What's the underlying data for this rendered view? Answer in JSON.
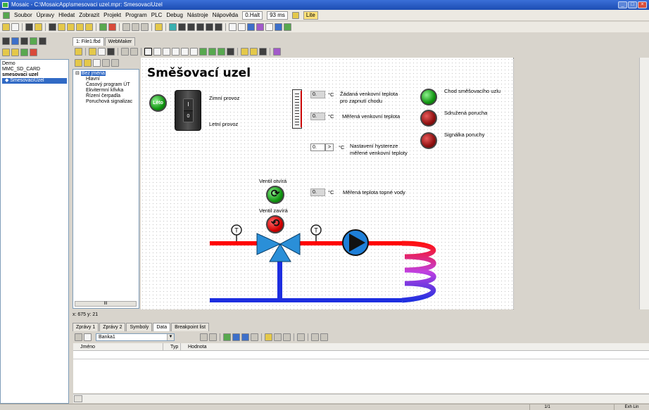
{
  "window": {
    "title": "Mosaic - C:\\MosaicApp\\smesovaci uzel.mpr: SmesovaciUzel"
  },
  "menu": {
    "items": [
      "Soubor",
      "Úpravy",
      "Hledat",
      "Zobrazit",
      "Projekt",
      "Program",
      "PLC",
      "Debug",
      "Nástroje",
      "Nápověda"
    ],
    "halt": "0.Halt",
    "cycle": "93 ms",
    "live": "Lite"
  },
  "left_tree": {
    "items": [
      "Demo",
      "MMC_SD_CARD",
      "smesovaci uzel",
      "SmesovaciUzel"
    ]
  },
  "editor_tabs": [
    "1: File1.fbd",
    "WebMaker"
  ],
  "page_tree": {
    "root": "Bez jména",
    "children": [
      "Hlavní",
      "Časový program ÚT",
      "Ekvitermní křivka",
      "Řízení čerpadla",
      "Poruchová signalizac"
    ]
  },
  "scene": {
    "title": "Směšovací uzel",
    "leto": "Léto",
    "switch_on": "I",
    "switch_off": "0",
    "winter": "Zimní provoz",
    "summer": "Letní provoz",
    "req_temp_value": "0.",
    "req_temp_unit": "°C",
    "req_temp_label_1": "Žádaná venkovní teplota",
    "req_temp_label_2": "pro zapnutí chodu",
    "meas_out_value": "0.",
    "meas_out_unit": "°C",
    "meas_out_label": "Měřená venkovní teplota",
    "hyst_value": "0.",
    "hyst_arrow": ">",
    "hyst_unit": "°C",
    "hyst_label_1": "Nastavení hystereze",
    "hyst_label_2": "měřené venkovní teploty",
    "lamp_run": "Chod směšovacího uzlu",
    "lamp_fault": "Sdružená porucha",
    "lamp_signal": "Signálka poruchy",
    "valve_open": "Ventil otvírá",
    "valve_close": "Ventil zavírá",
    "water_value": "0.",
    "water_unit": "°C",
    "water_label": "Měřená teplota topné vody",
    "sensor_mark": "T",
    "colors": {
      "hot": "#ff0000",
      "cold": "#1d2ee0",
      "valve": "#2a8fd8",
      "pump": "#1e7fd8"
    }
  },
  "tree_scroll_label": "III",
  "coords": "x: 675 y: 21",
  "bottom_tabs": [
    "Zprávy 1",
    "Zprávy 2",
    "Symboly",
    "Data",
    "Breakpoint list"
  ],
  "data_grid": {
    "bank": "Banka1",
    "columns": [
      "Jméno",
      "Typ",
      "Hodnota"
    ]
  },
  "status": {
    "page": "1/1",
    "mode": "Exh Lin"
  }
}
